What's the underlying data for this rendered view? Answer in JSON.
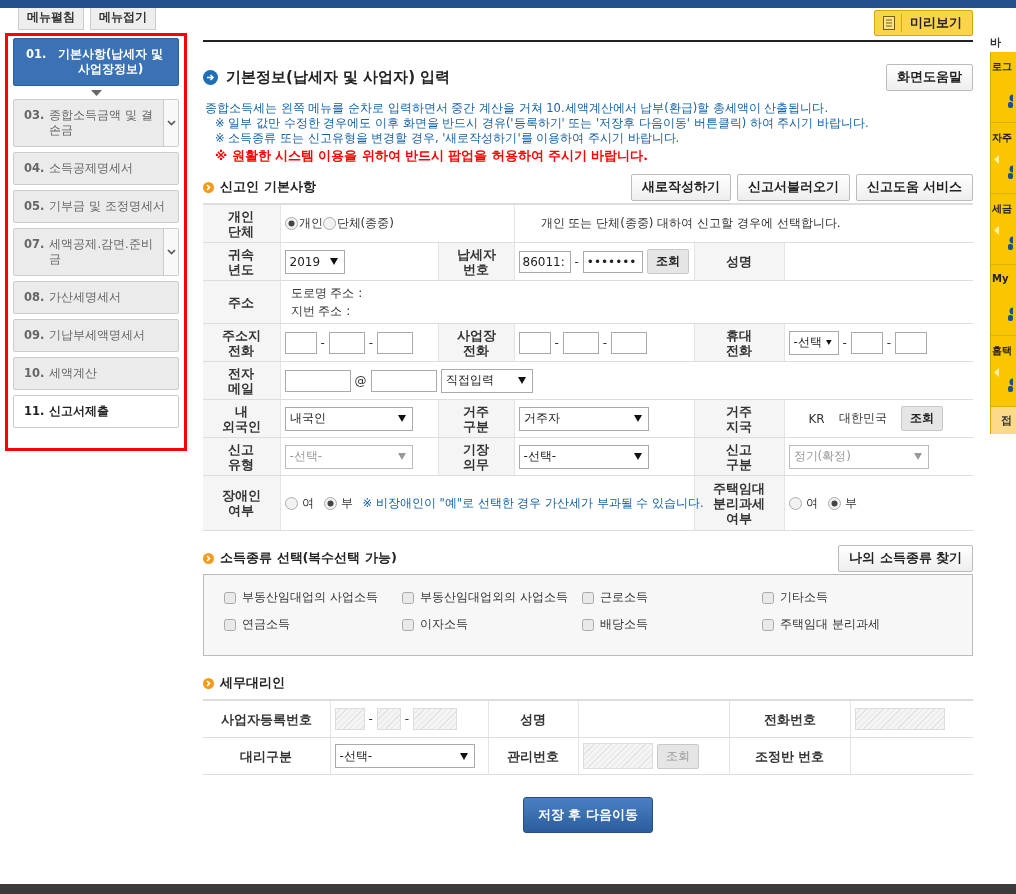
{
  "top_bar": {
    "menu_buttons": [
      {
        "label": "메뉴펼침"
      },
      {
        "label": "메뉴접기"
      }
    ]
  },
  "sidebar": {
    "items": [
      {
        "number": "01.",
        "label": "기본사항(납세자 및 사업장정보)",
        "selected": true,
        "disabled": false,
        "expandable": false
      },
      {
        "number": "03.",
        "label": "종합소득금액 및 결손금",
        "selected": false,
        "disabled": true,
        "expandable": true
      },
      {
        "number": "04.",
        "label": "소득공제명세서",
        "selected": false,
        "disabled": true,
        "expandable": false
      },
      {
        "number": "05.",
        "label": "기부금 및 조정명세서",
        "selected": false,
        "disabled": true,
        "expandable": false
      },
      {
        "number": "07.",
        "label": "세액공제.감면.준비금",
        "selected": false,
        "disabled": true,
        "expandable": true
      },
      {
        "number": "08.",
        "label": "가산세명세서",
        "selected": false,
        "disabled": true,
        "expandable": false
      },
      {
        "number": "09.",
        "label": "기납부세액명세서",
        "selected": false,
        "disabled": true,
        "expandable": false
      },
      {
        "number": "10.",
        "label": "세액계산",
        "selected": false,
        "disabled": true,
        "expandable": false
      },
      {
        "number": "11.",
        "label": "신고서제출",
        "selected": false,
        "disabled": false,
        "expandable": false
      }
    ]
  },
  "preview_button": "미리보기",
  "page_title": "기본정보(납세자 및 사업자) 입력",
  "help_button": "화면도움말",
  "notices": [
    {
      "kind": "intro",
      "text": "종합소득세는 왼쪽 메뉴를 순차로 입력하면서 중간 계산을 거쳐 10.세액계산에서 납부(환급)할 총세액이 산출됩니다."
    },
    {
      "kind": "note",
      "text": "※ 일부 값만 수정한 경우에도 이후 화면을 반드시 경유('등록하기' 또는 '저장후 다음이동' 버튼클릭) 하여 주시기 바랍니다."
    },
    {
      "kind": "note",
      "text": "※ 소득종류 또는 신고유형을 변경할 경우, '새로작성하기'를 이용하여 주시기 바랍니다."
    },
    {
      "kind": "warning",
      "text": "※ 원활한 시스템 이용을 위하여 반드시 팝업을 허용하여 주시기 바랍니다."
    }
  ],
  "reporter": {
    "title": "신고인 기본사항",
    "buttons": [
      "새로작성하기",
      "신고서불러오기",
      "신고도움 서비스"
    ],
    "entity": {
      "label": [
        "개인",
        "단체"
      ],
      "options": [
        {
          "label": "개인",
          "selected": true
        },
        {
          "label": "단체(종중)",
          "selected": false
        }
      ],
      "description": "개인 또는 단체(종중) 대하여 신고할 경우에 선택합니다."
    },
    "year": {
      "label": [
        "귀속",
        "년도"
      ],
      "value": "2019"
    },
    "taxpayer_no": {
      "label": [
        "납세자",
        "번호"
      ],
      "first": "86011:",
      "separator": "-",
      "second": "•••••••",
      "button": "조회"
    },
    "name": {
      "label": [
        "성명"
      ]
    },
    "address": {
      "label": [
        "주소"
      ],
      "lines": [
        "도로명 주소 :",
        "지번 주소 :"
      ]
    },
    "home_phone": {
      "label": [
        "주소지",
        "전화"
      ],
      "separators": [
        "-",
        "-"
      ]
    },
    "work_phone": {
      "label": [
        "사업장",
        "전화"
      ],
      "separators": [
        "-",
        "-"
      ]
    },
    "mobile": {
      "label": [
        "휴대",
        "전화"
      ],
      "carrier": "-선택",
      "separators": [
        "-",
        "-"
      ]
    },
    "email": {
      "label": [
        "전자",
        "메일"
      ],
      "at": "@",
      "domain": "직접입력"
    },
    "nationality": {
      "label": [
        "내",
        "외국인"
      ],
      "value": "내국인",
      "disabled": false
    },
    "residency": {
      "label": [
        "거주",
        "구분"
      ],
      "value": "거주자",
      "disabled": false
    },
    "country": {
      "label": [
        "거주",
        "지국"
      ],
      "code": "KR",
      "name": "대한민국",
      "button": "조회"
    },
    "report_type": {
      "label": [
        "신고",
        "유형"
      ],
      "value": "-선택-",
      "disabled": true
    },
    "bookkeeping": {
      "label": [
        "기장",
        "의무"
      ],
      "value": "-선택-",
      "disabled": false
    },
    "report_category": {
      "label": [
        "신고",
        "구분"
      ],
      "value": "정기(확정)",
      "disabled": true
    },
    "disabled_person": {
      "label": [
        "장애인",
        "여부"
      ],
      "options": [
        {
          "label": "여",
          "selected": false
        },
        {
          "label": "부",
          "selected": true
        }
      ],
      "note": "※ 비장애인이 \"예\"로 선택한 경우 가산세가 부과될 수 있습니다."
    },
    "rental_separate": {
      "label": [
        "주택임대",
        "분리과세",
        "여부"
      ],
      "options": [
        {
          "label": "여",
          "selected": false
        },
        {
          "label": "부",
          "selected": true
        }
      ]
    }
  },
  "income_types": {
    "title": "소득종류 선택(복수선택 가능)",
    "find_button": "나의 소득종류 찾기",
    "options": [
      {
        "label": "부동산임대업의 사업소득",
        "checked": false
      },
      {
        "label": "부동산임대업외의 사업소득",
        "checked": false
      },
      {
        "label": "근로소득",
        "checked": false
      },
      {
        "label": "기타소득",
        "checked": false
      },
      {
        "label": "연금소득",
        "checked": false
      },
      {
        "label": "이자소득",
        "checked": false
      },
      {
        "label": "배당소득",
        "checked": false
      },
      {
        "label": "주택임대 분리과세",
        "checked": false
      }
    ]
  },
  "tax_agent": {
    "title": "세무대리인",
    "disabled": true,
    "reg_no_label": "사업자등록번호",
    "reg_no_separators": [
      "-",
      "-"
    ],
    "name_label": "성명",
    "phone_label": "전화번호",
    "agent_type_label": "대리구분",
    "agent_type_value": "-선택-",
    "mgmt_no_label": "관리번호",
    "lookup_button": "조회",
    "team_no_label": "조정반 번호"
  },
  "save_button": "저장 후 다음이동",
  "quick_menu": {
    "title": "바",
    "items": [
      {
        "label": "로그",
        "arrow": false
      },
      {
        "label": "자주",
        "arrow": true
      },
      {
        "label": "세금",
        "arrow": true
      },
      {
        "label": "My",
        "arrow": false
      },
      {
        "label": "홈택",
        "arrow": true
      }
    ],
    "fold": "접"
  }
}
